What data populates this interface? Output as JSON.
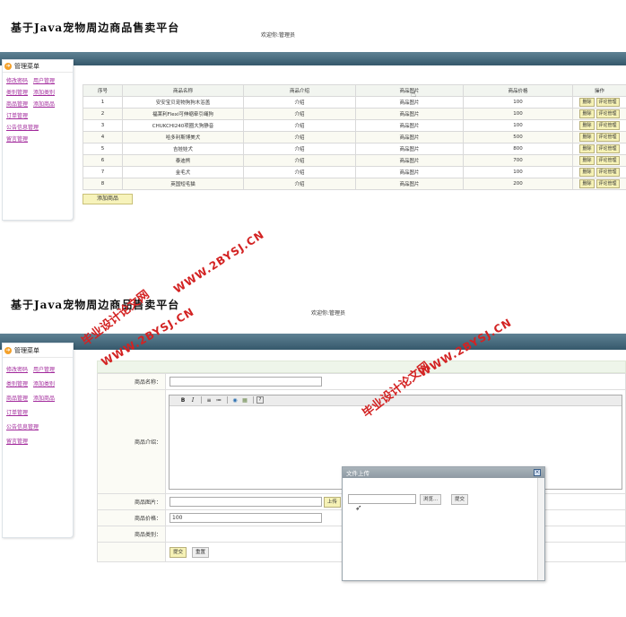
{
  "app": {
    "site_title": "基于Java宠物周边商品售卖平台",
    "welcome": "欢迎你:管理员"
  },
  "sidebar": {
    "title": "管理菜单",
    "rows": [
      [
        "修改密码",
        "用户管理"
      ],
      [
        "类别管理",
        "添加类别"
      ],
      [
        "商品管理",
        "添加商品"
      ],
      [
        "订单管理"
      ],
      [
        "公告信息管理"
      ],
      [
        "留言管理"
      ]
    ]
  },
  "product_list": {
    "columns": [
      "序号",
      "商品名称",
      "商品介绍",
      "商品图片",
      "商品价格",
      "操作"
    ],
    "rows": [
      [
        "1",
        "安安宝贝宠物狗狗木浴盖",
        "介绍",
        "商品图片",
        "100"
      ],
      [
        "2",
        "福莱利Flexi可伸缩牵引绳狗",
        "介绍",
        "商品图片",
        "100"
      ],
      [
        "3",
        "CHUKCHI240项圈大狗静音",
        "介绍",
        "商品图片",
        "100"
      ],
      [
        "4",
        "哈多利斯博美犬",
        "介绍",
        "商品图片",
        "500"
      ],
      [
        "5",
        "吉娃娃犬",
        "介绍",
        "商品图片",
        "800"
      ],
      [
        "6",
        "泰迪熊",
        "介绍",
        "商品图片",
        "700"
      ],
      [
        "7",
        "金毛犬",
        "介绍",
        "商品图片",
        "100"
      ],
      [
        "8",
        "英国短毛猫",
        "介绍",
        "商品图片",
        "200"
      ]
    ],
    "delete_label": "删除",
    "comment_label": "评论管理",
    "add_button": "添加商品"
  },
  "product_form": {
    "name_label": "商品名称：",
    "intro_label": "商品介绍：",
    "image_label": "商品图片：",
    "upload_button": "上传",
    "price_label": "商品价格：",
    "price_value": "100",
    "category_label": "商品类别：",
    "submit_button": "提交",
    "reset_button": "重置",
    "editor_tools": [
      "B",
      "I",
      "≡",
      "≔",
      "◉",
      "▦",
      "?"
    ]
  },
  "upload_dialog": {
    "title": "文件上传",
    "close_glyph": "×",
    "browse_button": "浏览...",
    "submit_button": "提交"
  },
  "watermarks": {
    "url": "WWW.2BYSJ.CN",
    "site": "毕业设计论文网"
  }
}
